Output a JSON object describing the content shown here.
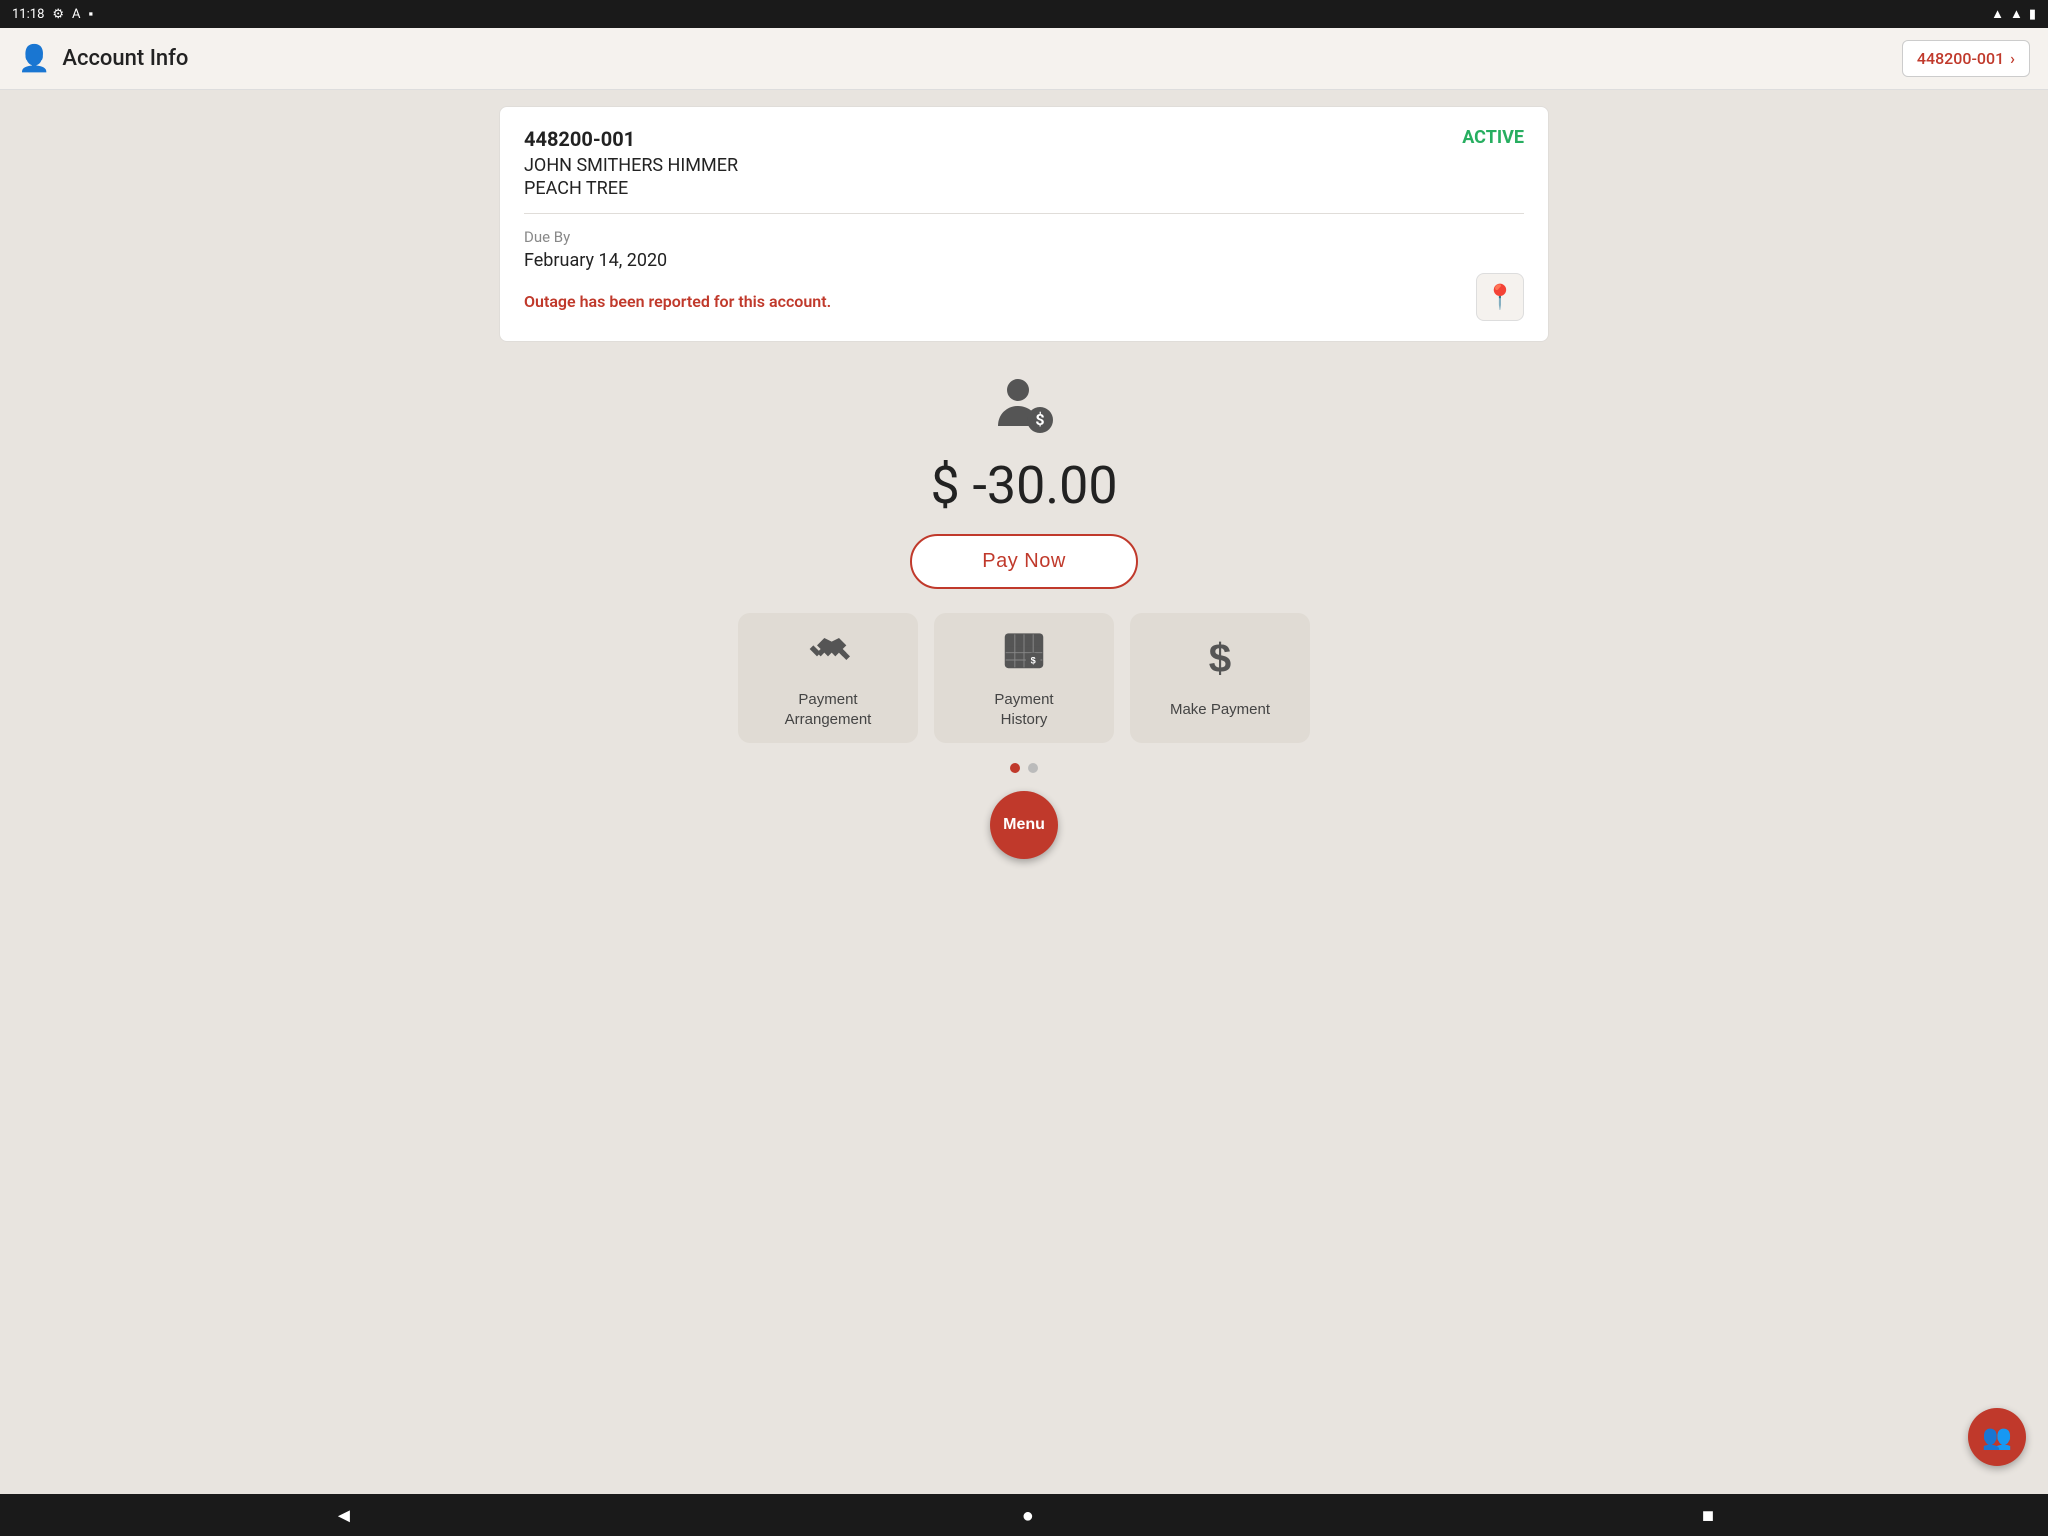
{
  "statusBar": {
    "time": "11:18",
    "icons": [
      "settings",
      "a",
      "sim"
    ]
  },
  "appBar": {
    "title": "Account Info",
    "accountNumber": "448200-001",
    "chevron": "›"
  },
  "accountCard": {
    "accountNumber": "448200-001",
    "status": "ACTIVE",
    "customerName": "JOHN SMITHERS HIMMER",
    "location": "PEACH TREE",
    "dueLabel": "Due By",
    "dueDate": "February 14, 2020",
    "outageMessage": "Outage has been reported for this account."
  },
  "balance": {
    "amount": "$ -30.00",
    "payNowLabel": "Pay Now"
  },
  "actions": [
    {
      "id": "payment-arrangement",
      "label": "Payment\nArrangement",
      "icon": "handshake"
    },
    {
      "id": "payment-history",
      "label": "Payment\nHistory",
      "icon": "calendar-dollar"
    },
    {
      "id": "make-payment",
      "label": "Make Payment",
      "icon": "dollar"
    }
  ],
  "menu": {
    "label": "Menu"
  },
  "colors": {
    "red": "#c0392b",
    "green": "#27ae60",
    "dark": "#1a1a1a",
    "cardBg": "#ffffff",
    "pageBg": "#e8e4df"
  }
}
